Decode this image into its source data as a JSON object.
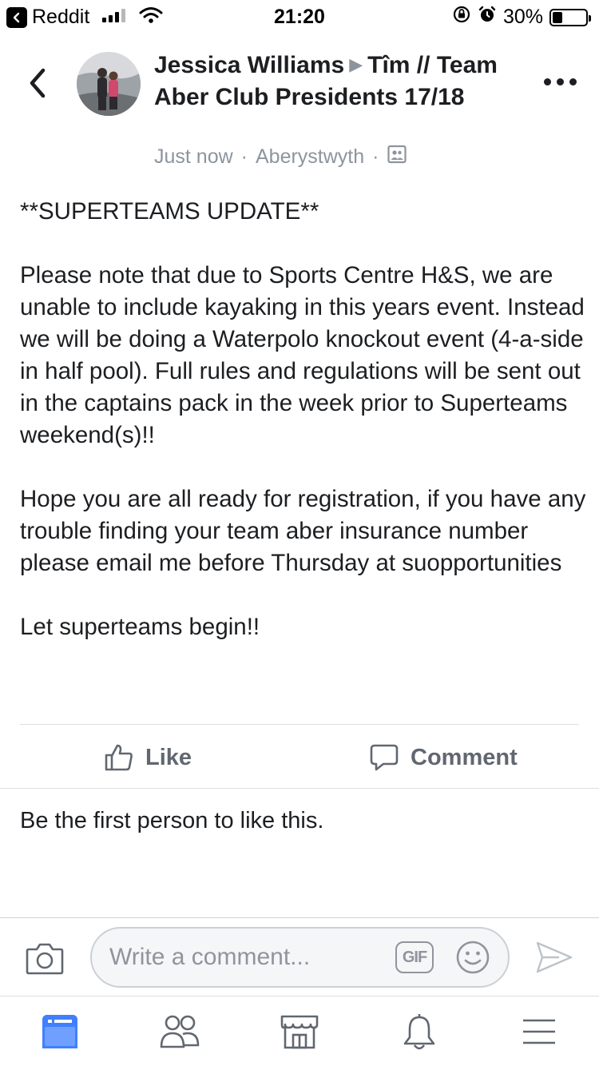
{
  "status_bar": {
    "back_app": "Reddit",
    "time": "21:20",
    "battery_percent": "30%",
    "battery_level": 0.3
  },
  "post": {
    "author": "Jessica Williams",
    "group": "Tîm // Team Aber Club Presidents 17/18",
    "time": "Just now",
    "location": "Aberystwyth",
    "paragraphs": [
      "**SUPERTEAMS UPDATE**",
      "Please note that due to Sports Centre H&S, we are unable to include kayaking in this years event. Instead we will be doing a Waterpolo knockout event (4-a-side in half pool). Full rules and regulations will be sent out in the captains pack in the week prior to Superteams weekend(s)!!",
      "Hope you are all ready for registration, if you have any trouble finding your team aber insurance number please email me before Thursday at suopportunities",
      "Let superteams begin!!"
    ]
  },
  "actions": {
    "like": "Like",
    "comment": "Comment"
  },
  "likes_summary": "Be the first person to like this.",
  "composer": {
    "placeholder": "Write a comment...",
    "gif_label": "GIF"
  },
  "colors": {
    "text": "#1c1e21",
    "secondary": "#606770",
    "meta": "#8d949e",
    "accent": "#4080ff"
  },
  "tabs": [
    "news-feed-icon",
    "friends-icon",
    "marketplace-icon",
    "notifications-icon",
    "menu-icon"
  ]
}
